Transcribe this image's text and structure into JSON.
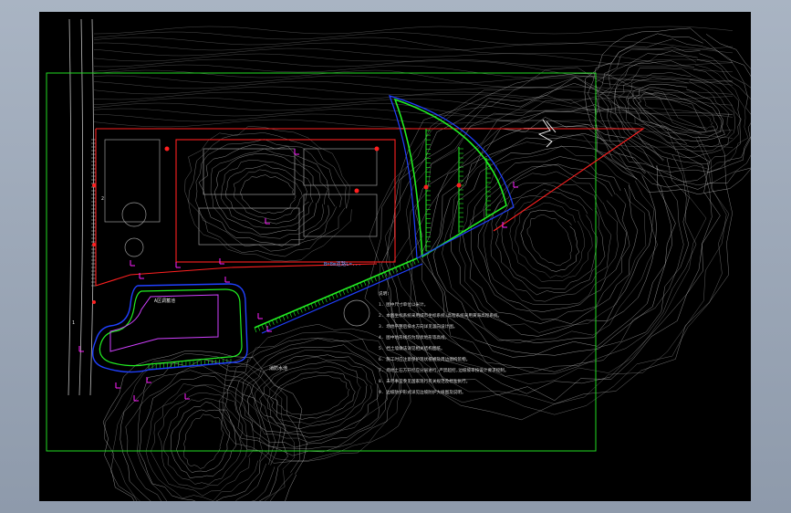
{
  "drawing": {
    "background": "#000000",
    "frame_color": "#22dd22",
    "boundary_color": "#ff2020",
    "retaining_color": "#22ee22",
    "outline_color": "#2040ff",
    "marker_color": "#ff20ff",
    "contour_color": "#cfcfcf"
  },
  "labels": {
    "road_label": "B=8m道路L=...",
    "pond_label": "A区调蓄池",
    "lower_area_label": "消防水池",
    "small_tag_1": "1",
    "small_tag_2": "2"
  },
  "notes": {
    "heading": "说明:",
    "lines": [
      "1. 图中尺寸单位以米计。",
      "2. 本图坐标系统采用城市坐标系统,高程系统采用黄海高程系统。",
      "3. 场地平整后排水方向详见竖向设计图。",
      "4. 图中地形线均为现状地形等高线。",
      "5. 挡土墙做法详见相关结构图纸。",
      "6. 施工时应注意保护现状植被及周边建构筑物。",
      "7. 场地土石方开挖应分层进行,严禁超挖,边坡坡率按设计要求控制。",
      "8. 未尽事宜参见国家现行有关规范及标准执行。",
      "9. 边坡防护形式详见边坡防护大样图及说明。"
    ]
  }
}
